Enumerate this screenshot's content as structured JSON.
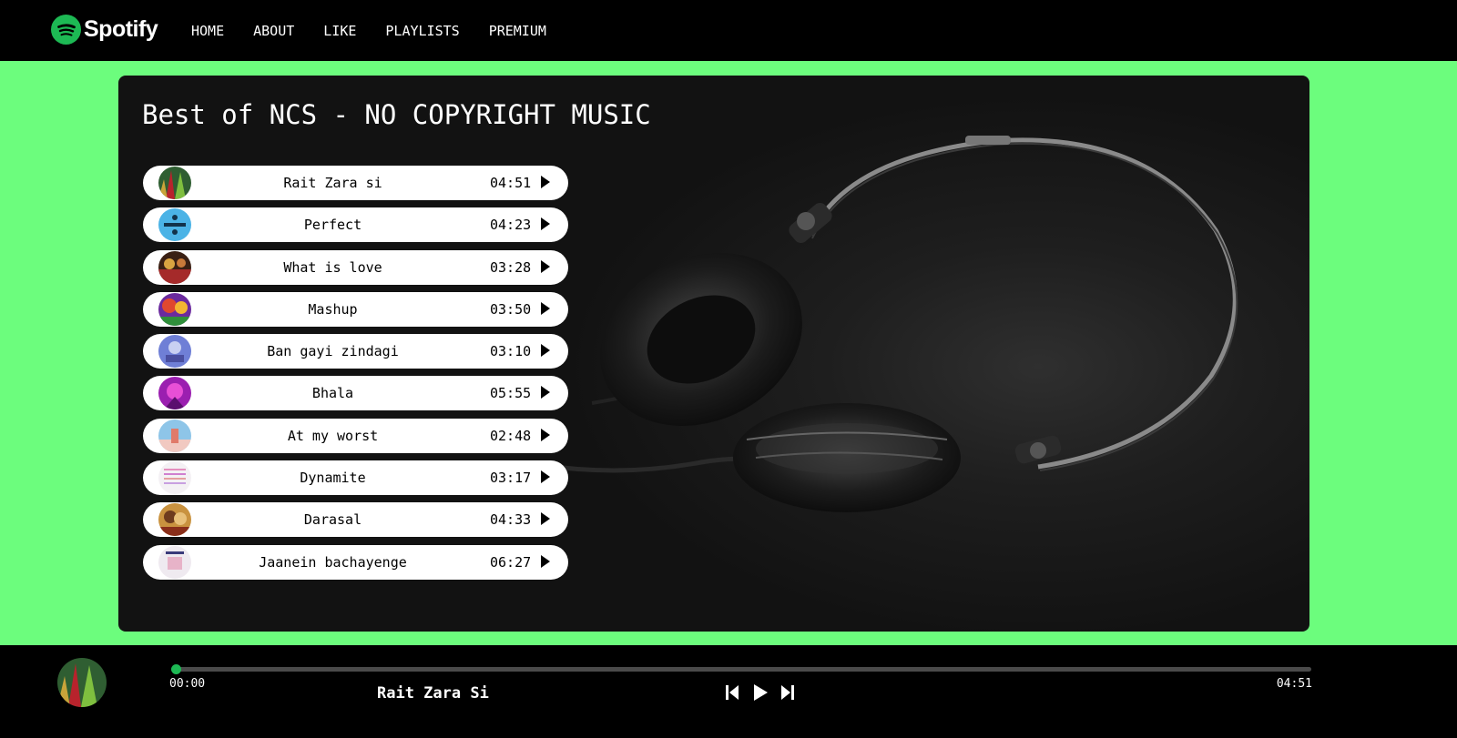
{
  "brand": {
    "name": "Spotify",
    "color": "#1db954"
  },
  "nav": {
    "items": [
      "HOME",
      "ABOUT",
      "LIKE",
      "PLAYLISTS",
      "PREMIUM"
    ]
  },
  "playlist": {
    "title": "Best of NCS - NO COPYRIGHT MUSIC",
    "songs": [
      {
        "name": "Rait Zara si",
        "duration": "04:51",
        "icon": "play-icon"
      },
      {
        "name": "Perfect",
        "duration": "04:23",
        "icon": "play-icon"
      },
      {
        "name": "What is love",
        "duration": "03:28",
        "icon": "play-icon"
      },
      {
        "name": "Mashup",
        "duration": "03:50",
        "icon": "play-icon"
      },
      {
        "name": "Ban gayi zindagi",
        "duration": "03:10",
        "icon": "play-icon"
      },
      {
        "name": "Bhala",
        "duration": "05:55",
        "icon": "play-icon"
      },
      {
        "name": "At my worst",
        "duration": "02:48",
        "icon": "play-icon"
      },
      {
        "name": "Dynamite",
        "duration": "03:17",
        "icon": "play-icon"
      },
      {
        "name": "Darasal",
        "duration": "04:33",
        "icon": "play-icon"
      },
      {
        "name": "Jaanein bachayenge",
        "duration": "06:27",
        "icon": "play-icon"
      }
    ]
  },
  "player": {
    "current_time": "00:00",
    "total_time": "04:51",
    "now_playing": "Rait Zara Si",
    "progress": 0.0,
    "controls": [
      "previous-icon",
      "play-icon",
      "next-icon"
    ]
  },
  "colors": {
    "stage_bg": "#6cfd7d",
    "accent": "#1db954"
  }
}
